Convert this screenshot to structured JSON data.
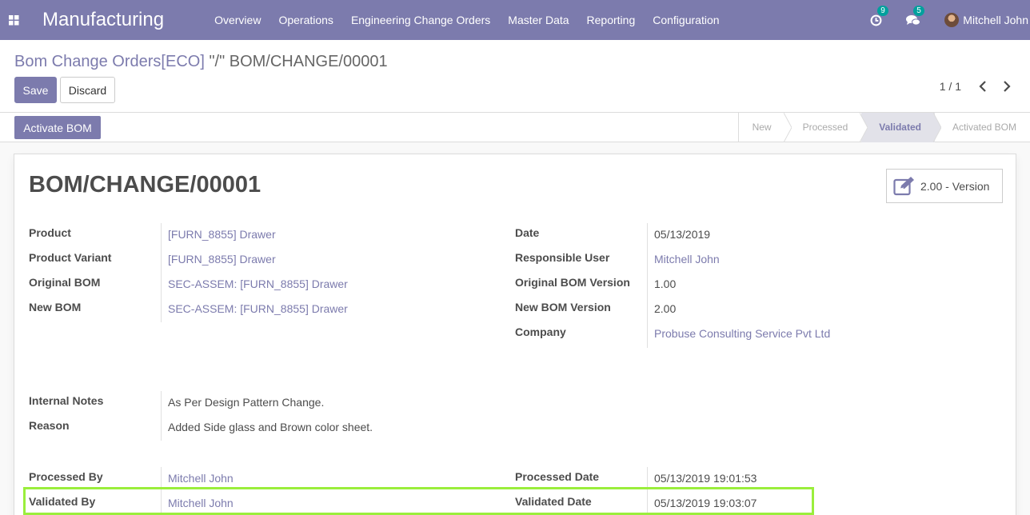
{
  "navbar": {
    "app_title": "Manufacturing",
    "menu": [
      "Overview",
      "Operations",
      "Engineering Change Orders",
      "Master Data",
      "Reporting",
      "Configuration"
    ],
    "activity_count": "9",
    "message_count": "5",
    "user_name": "Mitchell John"
  },
  "breadcrumb": {
    "parent": "Bom Change Orders[ECO]",
    "current": "\"/\" BOM/CHANGE/00001"
  },
  "buttons": {
    "save": "Save",
    "discard": "Discard",
    "activate": "Activate BOM"
  },
  "pager": {
    "value": "1 / 1"
  },
  "stages": [
    {
      "label": "New",
      "current": false
    },
    {
      "label": "Processed",
      "current": false
    },
    {
      "label": "Validated",
      "current": true
    },
    {
      "label": "Activated BOM",
      "current": false
    }
  ],
  "record": {
    "name": "BOM/CHANGE/00001",
    "version_button": "2.00 - Version",
    "fields_left": [
      {
        "label": "Product",
        "value": "[FURN_8855] Drawer"
      },
      {
        "label": "Product Variant",
        "value": "[FURN_8855] Drawer"
      },
      {
        "label": "Original BOM",
        "value": "SEC-ASSEM: [FURN_8855] Drawer"
      },
      {
        "label": "New BOM",
        "value": "SEC-ASSEM: [FURN_8855] Drawer"
      }
    ],
    "fields_right": [
      {
        "label": "Date",
        "value": "05/13/2019"
      },
      {
        "label": "Responsible User",
        "value": "Mitchell John"
      },
      {
        "label": "Original BOM Version",
        "value": "1.00"
      },
      {
        "label": "New BOM Version",
        "value": "2.00"
      },
      {
        "label": "Company",
        "value": "Probuse Consulting Service Pvt Ltd"
      }
    ],
    "notes": [
      {
        "label": "Internal Notes",
        "value": "As Per Design Pattern Change."
      },
      {
        "label": "Reason",
        "value": "Added Side glass and Brown color sheet."
      }
    ],
    "tracking": {
      "processed_by_label": "Processed By",
      "processed_by": "Mitchell John",
      "processed_date_label": "Processed Date",
      "processed_date": "05/13/2019 19:01:53",
      "validated_by_label": "Validated By",
      "validated_by": "Mitchell John",
      "validated_date_label": "Validated Date",
      "validated_date": "05/13/2019 19:03:07"
    }
  },
  "colors": {
    "brand": "#7c7bad",
    "highlight": "#9aee3c",
    "badge": "#00a09d"
  },
  "icons": [
    "apps-grid-icon",
    "activity-clock-icon",
    "chat-bubbles-icon",
    "chevron-left-icon",
    "chevron-right-icon",
    "edit-version-icon"
  ]
}
